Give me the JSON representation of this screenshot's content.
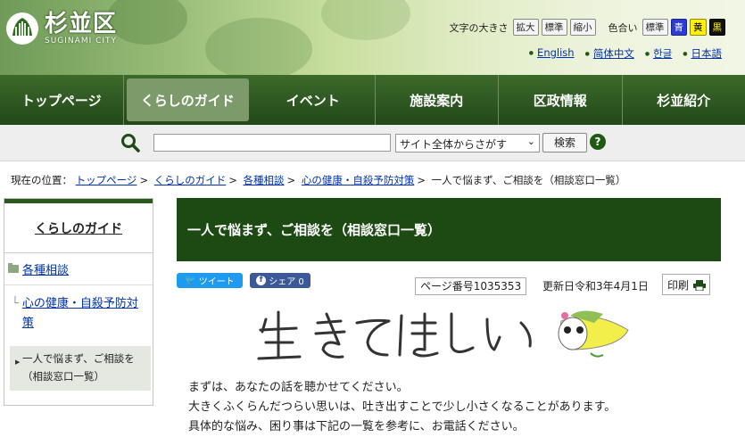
{
  "header": {
    "logo_name": "杉並区",
    "logo_sub": "SUGINAMI CITY",
    "font_size_label": "文字の大きさ",
    "font_buttons": [
      "拡大",
      "標準",
      "縮小"
    ],
    "color_label": "色合い",
    "color_buttons": [
      "標準",
      "青",
      "黄",
      "黒"
    ],
    "languages": [
      "English",
      "简体中文",
      "한글",
      "日本語"
    ]
  },
  "gnav": [
    "トップページ",
    "くらしのガイド",
    "イベント",
    "施設案内",
    "区政情報",
    "杉並紹介"
  ],
  "search": {
    "input_value": "",
    "scope_selected": "サイト全体からさがす",
    "button_label": "検索",
    "help_label": "?"
  },
  "breadcrumb": {
    "prefix": "現在の位置：",
    "links": [
      "トップページ",
      "くらしのガイド",
      "各種相談",
      "心の健康・自殺予防対策"
    ],
    "current": "一人で悩まず、ご相談を（相談窓口一覧）"
  },
  "sidebar": {
    "title": "くらしのガイド",
    "level1": "各種相談",
    "level2": "心の健康・自殺予防対策",
    "current": "一人で悩まず、ご相談を（相談窓口一覧）"
  },
  "page": {
    "title": "一人で悩まず、ご相談を（相談窓口一覧）",
    "tweet_label": "ツイート",
    "share_label": "シェア 0",
    "page_number": "ページ番号1035353",
    "updated": "更新日令和3年4月1日",
    "print_label": "印刷",
    "paragraphs": [
      "まずは、あなたの話を聴かせてください。",
      "大きくふくらんだつらい思いは、吐き出すことで少し小さくなることがあります。",
      "具体的な悩み、困り事は下記の一覧を参考に、お電話ください。"
    ]
  }
}
